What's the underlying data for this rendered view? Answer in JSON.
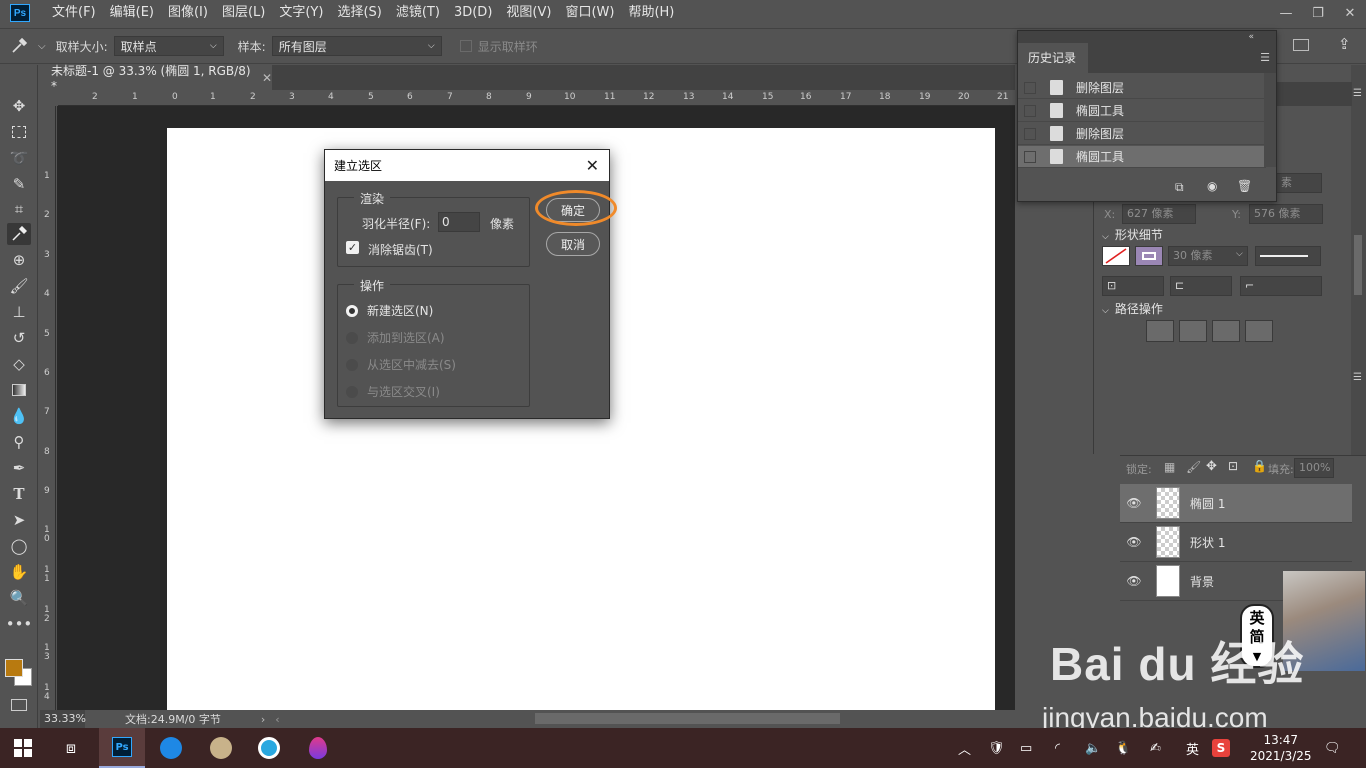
{
  "app": {
    "logo": "Ps",
    "menu": [
      "文件(F)",
      "编辑(E)",
      "图像(I)",
      "图层(L)",
      "文字(Y)",
      "选择(S)",
      "滤镜(T)",
      "3D(D)",
      "视图(V)",
      "窗口(W)",
      "帮助(H)"
    ],
    "window_controls": [
      "—",
      "❐",
      "✕"
    ]
  },
  "options_bar": {
    "sample_size_label": "取样大小:",
    "sample_size_value": "取样点",
    "sample_label": "样本:",
    "sample_value": "所有图层",
    "show_ring_label": "显示取样环"
  },
  "document": {
    "tab_title": "未标题-1 @ 33.3% (椭圆 1, RGB/8) *",
    "zoom": "33.33%",
    "doc_info": "文档:24.9M/0 字节"
  },
  "ruler": {
    "top_ticks": [
      "2",
      "1",
      "0",
      "1",
      "2",
      "3",
      "4",
      "5",
      "6",
      "7",
      "8",
      "9",
      "10",
      "11",
      "12",
      "13",
      "14",
      "15",
      "16",
      "17",
      "18",
      "19",
      "20",
      "21"
    ],
    "left_ticks": [
      "1",
      "2",
      "3",
      "4",
      "5",
      "6",
      "7",
      "8",
      "9",
      "10",
      "11",
      "12",
      "13",
      "14"
    ]
  },
  "history": {
    "title": "历史记录",
    "items": [
      {
        "label": "删除图层",
        "selected": false
      },
      {
        "label": "椭圆工具",
        "selected": false
      },
      {
        "label": "删除图层",
        "selected": false
      },
      {
        "label": "椭圆工具",
        "selected": true
      }
    ]
  },
  "properties": {
    "x_label": "X:",
    "x_value": "627 像素",
    "y_label": "Y:",
    "y_value": "576 像素",
    "pixel_value_hidden": "素",
    "shape_details": "形状细节",
    "stroke_width": "30 像素",
    "path_ops": "路径操作"
  },
  "layers": {
    "lock_label": "锁定:",
    "fill_label": "填充:",
    "fill_value": "100%",
    "items": [
      {
        "name": "椭圆 1",
        "type": "shape",
        "selected": true
      },
      {
        "name": "形状 1",
        "type": "shape",
        "selected": false
      },
      {
        "name": "背景",
        "type": "background",
        "selected": false
      }
    ]
  },
  "dialog": {
    "title": "建立选区",
    "render_group": "渲染",
    "feather_label": "羽化半径(F):",
    "feather_value": "0",
    "feather_unit": "像素",
    "antialias_label": "消除锯齿(T)",
    "antialias_checked": true,
    "operation_group": "操作",
    "operations": [
      {
        "label": "新建选区(N)",
        "selected": true,
        "enabled": true
      },
      {
        "label": "添加到选区(A)",
        "selected": false,
        "enabled": false
      },
      {
        "label": "从选区中减去(S)",
        "selected": false,
        "enabled": false
      },
      {
        "label": "与选区交叉(I)",
        "selected": false,
        "enabled": false
      }
    ],
    "ok_label": "确定",
    "cancel_label": "取消",
    "highlight_color": "#f08a2a"
  },
  "taskbar": {
    "time": "13:47",
    "date": "2021/3/25",
    "ime_lang": "英",
    "ime_badge_1": "英",
    "ime_badge_2": "简"
  },
  "watermark": {
    "brand": "Bai du 经验",
    "url": "jingyan.baidu.com"
  },
  "colors": {
    "ps_blue": "#31a8ff",
    "foreground_swatch": "#b87a10",
    "taskbar": "#3b2424"
  }
}
